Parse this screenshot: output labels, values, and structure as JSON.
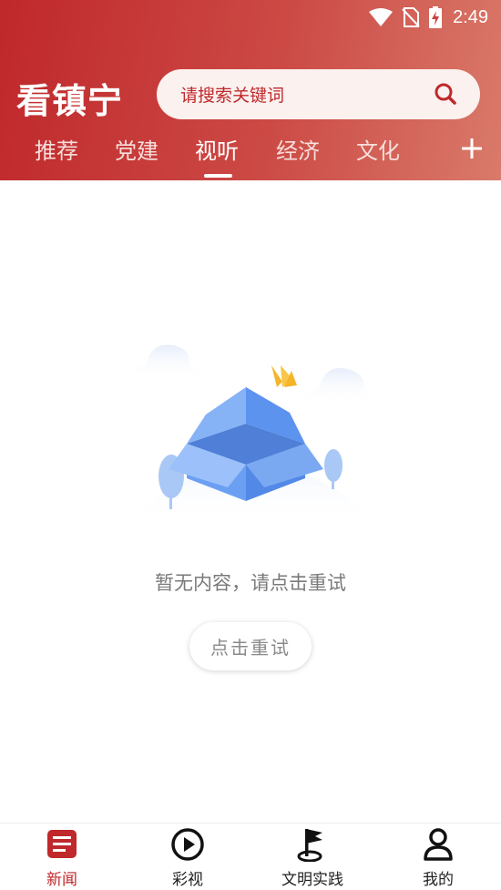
{
  "status_bar": {
    "time": "2:49"
  },
  "header": {
    "title": "看镇宁",
    "search_placeholder": "请搜索关键词"
  },
  "tabs": [
    {
      "label": "推荐",
      "active": false
    },
    {
      "label": "党建",
      "active": false
    },
    {
      "label": "视听",
      "active": true
    },
    {
      "label": "经济",
      "active": false
    },
    {
      "label": "文化",
      "active": false
    }
  ],
  "empty_state": {
    "message": "暂无内容，请点击重试",
    "retry_label": "点击重试"
  },
  "bottom_nav": [
    {
      "label": "新闻",
      "icon": "news-icon",
      "active": true
    },
    {
      "label": "彩视",
      "icon": "play-icon",
      "active": false
    },
    {
      "label": "文明实践",
      "icon": "flag-icon",
      "active": false
    },
    {
      "label": "我的",
      "icon": "user-icon",
      "active": false
    }
  ],
  "colors": {
    "brand_red": "#c0282b",
    "header_gradient_end": "#d97a6a",
    "box_blue": "#5b93ee"
  }
}
